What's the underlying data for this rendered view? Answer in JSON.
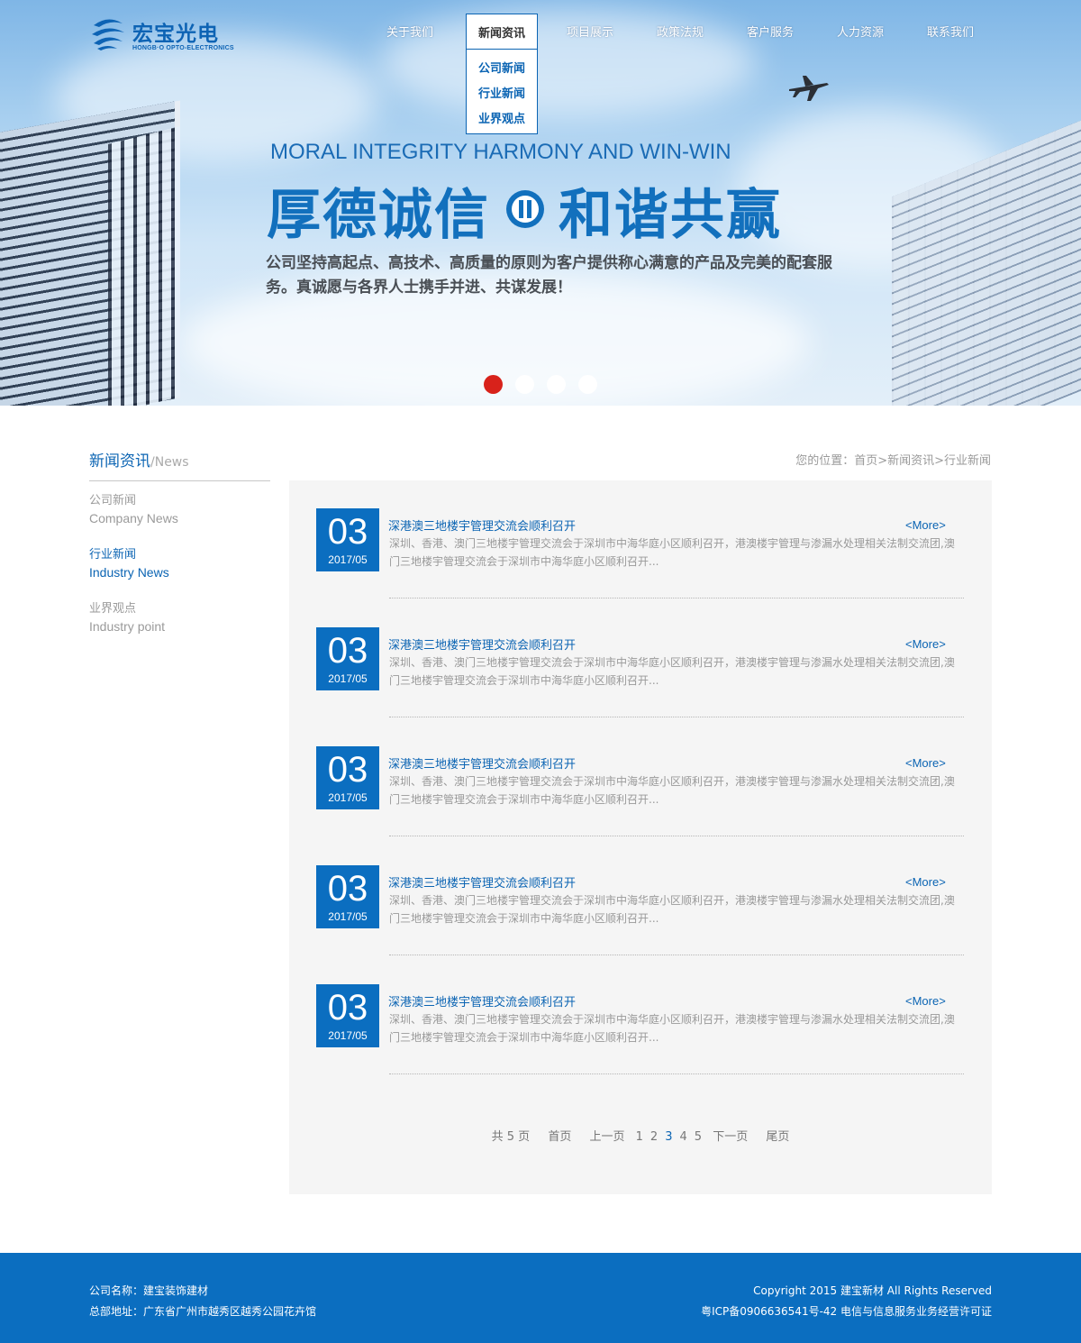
{
  "header": {
    "logo_cn": "宏宝光电",
    "logo_en": "HONGB·O OPTO-ELECTRONICS",
    "nav": [
      {
        "label": "关于我们"
      },
      {
        "label": "新闻资讯"
      },
      {
        "label": "项目展示"
      },
      {
        "label": "政策法规"
      },
      {
        "label": "客户服务"
      },
      {
        "label": "人力资源"
      },
      {
        "label": "联系我们"
      }
    ],
    "dropdown": [
      "公司新闻",
      "行业新闻",
      "业界观点"
    ]
  },
  "banner": {
    "slogan_en": "MORAL INTEGRITY HARMONY AND WIN-WIN",
    "slogan_cn_1": "厚德诚信",
    "slogan_cn_2": "和谐共赢",
    "body": "公司坚持高起点、高技术、高质量的原则为客户提供称心满意的产品及完美的配套服务。真诚愿与各界人士携手并进、共谋发展！",
    "active_slide": 1,
    "slides": 4,
    "accent_color": "#d8221b"
  },
  "sidebar": {
    "title_cn": "新闻资讯",
    "title_en": "/News",
    "items": [
      {
        "cn": "公司新闻",
        "en": "Company News",
        "active": false
      },
      {
        "cn": "行业新闻",
        "en": "Industry News",
        "active": true
      },
      {
        "cn": "业界观点",
        "en": "Industry point",
        "active": false
      }
    ]
  },
  "breadcrumb": "您的位置：首页>新闻资讯>行业新闻",
  "news": [
    {
      "day": "03",
      "ym": "2017/05",
      "title": "深港澳三地楼宇管理交流会顺利召开",
      "more": "<More>",
      "desc": "深圳、香港、澳门三地楼宇管理交流会于深圳市中海华庭小区顺利召开，港澳楼宇管理与渗漏水处理相关法制交流团,澳门三地楼宇管理交流会于深圳市中海华庭小区顺利召开..."
    },
    {
      "day": "03",
      "ym": "2017/05",
      "title": "深港澳三地楼宇管理交流会顺利召开",
      "more": "<More>",
      "desc": "深圳、香港、澳门三地楼宇管理交流会于深圳市中海华庭小区顺利召开，港澳楼宇管理与渗漏水处理相关法制交流团,澳门三地楼宇管理交流会于深圳市中海华庭小区顺利召开..."
    },
    {
      "day": "03",
      "ym": "2017/05",
      "title": "深港澳三地楼宇管理交流会顺利召开",
      "more": "<More>",
      "desc": "深圳、香港、澳门三地楼宇管理交流会于深圳市中海华庭小区顺利召开，港澳楼宇管理与渗漏水处理相关法制交流团,澳门三地楼宇管理交流会于深圳市中海华庭小区顺利召开..."
    },
    {
      "day": "03",
      "ym": "2017/05",
      "title": "深港澳三地楼宇管理交流会顺利召开",
      "more": "<More>",
      "desc": "深圳、香港、澳门三地楼宇管理交流会于深圳市中海华庭小区顺利召开，港澳楼宇管理与渗漏水处理相关法制交流团,澳门三地楼宇管理交流会于深圳市中海华庭小区顺利召开..."
    },
    {
      "day": "03",
      "ym": "2017/05",
      "title": "深港澳三地楼宇管理交流会顺利召开",
      "more": "<More>",
      "desc": "深圳、香港、澳门三地楼宇管理交流会于深圳市中海华庭小区顺利召开，港澳楼宇管理与渗漏水处理相关法制交流团,澳门三地楼宇管理交流会于深圳市中海华庭小区顺利召开..."
    }
  ],
  "pager": {
    "total": "共 5 页",
    "first": "首页",
    "prev": "上一页",
    "pages": [
      "1",
      "2",
      "3",
      "4",
      "5"
    ],
    "current": "3",
    "next": "下一页",
    "last": "尾页"
  },
  "footer": {
    "company": "公司名称：建宝装饰建材",
    "address": "总部地址：广东省广州市越秀区越秀公园花卉馆",
    "copyright": "Copyright 2015 建宝新材 All Rights Reserved",
    "icp": "粤ICP备0906636541号-42  电信与信息服务业务经营许可证"
  },
  "colors": {
    "brand": "#0b6ec0",
    "link": "#0b64b3",
    "panel": "#f5f5f5"
  }
}
